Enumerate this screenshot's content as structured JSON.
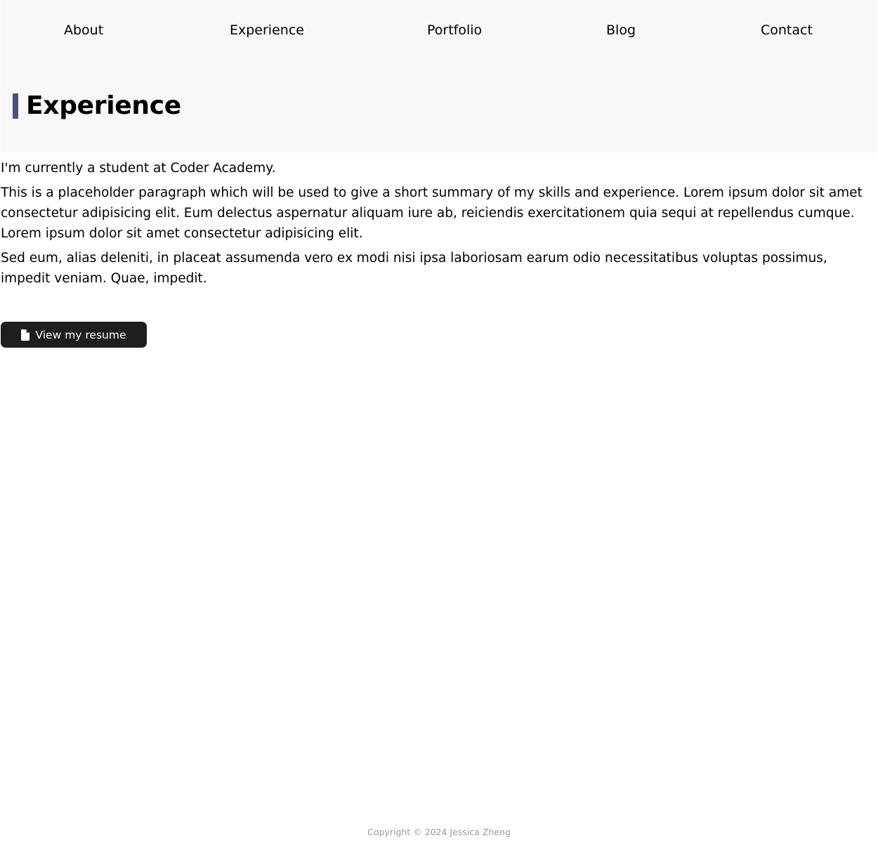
{
  "nav": {
    "items": [
      {
        "label": "About"
      },
      {
        "label": "Experience"
      },
      {
        "label": "Portfolio"
      },
      {
        "label": "Blog"
      },
      {
        "label": "Contact"
      }
    ]
  },
  "section": {
    "title": "Experience",
    "accent_color": "#4a5080",
    "paragraphs": [
      "I'm currently a student at Coder Academy.",
      "This is a placeholder paragraph which will be used to give a short summary of my skills and experience. Lorem ipsum dolor sit amet consectetur adipisicing elit. Eum delectus aspernatur aliquam iure ab, reiciendis exercitationem quia sequi at repellendus cumque. Lorem ipsum dolor sit amet consectetur adipisicing elit.",
      "Sed eum, alias deleniti, in placeat assumenda vero ex modi nisi ipsa laboriosam earum odio necessitatibus voluptas possimus, impedit veniam. Quae, impedit."
    ]
  },
  "resume_button": {
    "label": "View my resume",
    "icon": "file-icon"
  },
  "footer": {
    "copyright": "Copyright © 2024 Jessica Zheng"
  }
}
